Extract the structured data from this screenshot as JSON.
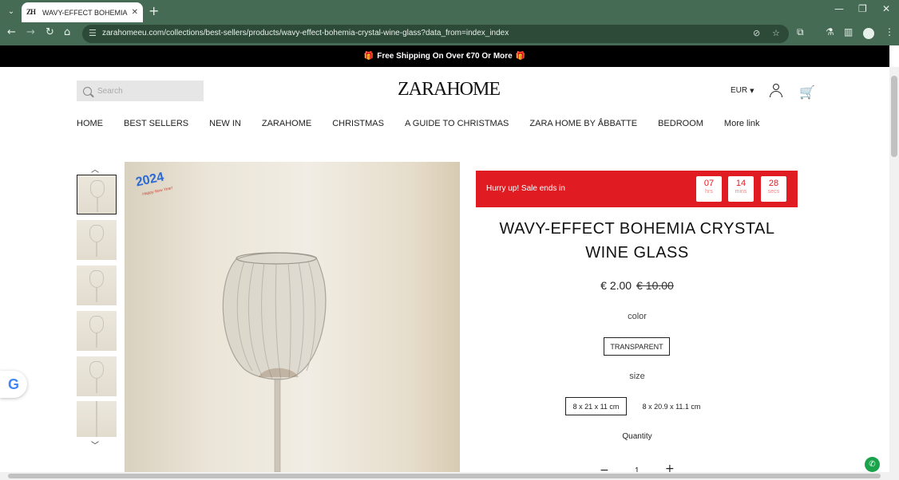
{
  "browser": {
    "tab_title": "WAVY-EFFECT BOHEMIA CRYSTAL",
    "tab_favicon": "ZH",
    "url": "zarahomeeu.com/collections/best-sellers/products/wavy-effect-bohemia-crystal-wine-glass?data_from=index_index",
    "accent": "#456b55"
  },
  "announcement": {
    "text": "Free Shipping On Over €70 Or More"
  },
  "header": {
    "search_placeholder": "Search",
    "logo": "ZARAHOME",
    "currency": "EUR"
  },
  "nav": {
    "items": [
      "HOME",
      "BEST SELLERS",
      "NEW IN",
      "ZARAHOME",
      "CHRISTMAS",
      "A GUIDE TO CHRISTMAS",
      "ZARA HOME BY ǺBBATTE",
      "BEDROOM",
      "More link"
    ]
  },
  "gallery": {
    "badge_year": "2024",
    "badge_text": "Happy New Year!"
  },
  "sale": {
    "text": "Hurry up!  Sale ends in",
    "timer": [
      {
        "value": "07",
        "unit": "hrs"
      },
      {
        "value": "14",
        "unit": "mins"
      },
      {
        "value": "28",
        "unit": "secs"
      }
    ],
    "color": "#e11b22"
  },
  "product": {
    "title": "WAVY-EFFECT BOHEMIA CRYSTAL WINE GLASS",
    "price": "€ 2.00",
    "old_price": "€ 10.00",
    "color_label": "color",
    "color_option": "TRANSPARENT",
    "size_label": "size",
    "size_options": [
      "8 x 21 x 11 cm",
      "8 x 20.9 x 11.1 cm"
    ],
    "quantity_label": "Quantity",
    "quantity": "1"
  }
}
